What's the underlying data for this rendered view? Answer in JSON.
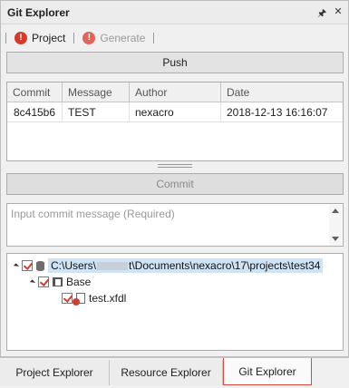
{
  "window": {
    "title": "Git Explorer",
    "icons": [
      "pin-icon",
      "close-icon"
    ]
  },
  "toolbar": {
    "items": [
      {
        "label": "Project",
        "icon": "error-icon",
        "enabled": true
      },
      {
        "label": "Generate",
        "icon": "error-icon",
        "enabled": false
      }
    ]
  },
  "push_label": "Push",
  "commits_table": {
    "columns": [
      "Commit",
      "Message",
      "Author",
      "Date"
    ],
    "rows": [
      {
        "commit": "8c415b6",
        "message": "TEST",
        "author": "nexacro",
        "date": "2018-12-13 16:16:07"
      }
    ]
  },
  "commit_label": "Commit",
  "commit_message": {
    "value": "",
    "placeholder": "Input commit message (Required)"
  },
  "tree": {
    "root": {
      "path_prefix": "C:\\Users\\",
      "path_suffix": "t\\Documents\\nexacro\\17\\projects\\test34",
      "checked": true
    },
    "folder": {
      "label": "Base",
      "checked": true
    },
    "file": {
      "label": "test.xfdl",
      "checked": true,
      "status": "error"
    }
  },
  "bottom_tabs": [
    {
      "label": "Project Explorer",
      "active": false
    },
    {
      "label": "Resource Explorer",
      "active": false
    },
    {
      "label": "Git Explorer",
      "active": true
    }
  ],
  "colors": {
    "error": "#d33b2c",
    "selection": "#cfe3f7",
    "active_tab_border": "#d84b3f"
  }
}
